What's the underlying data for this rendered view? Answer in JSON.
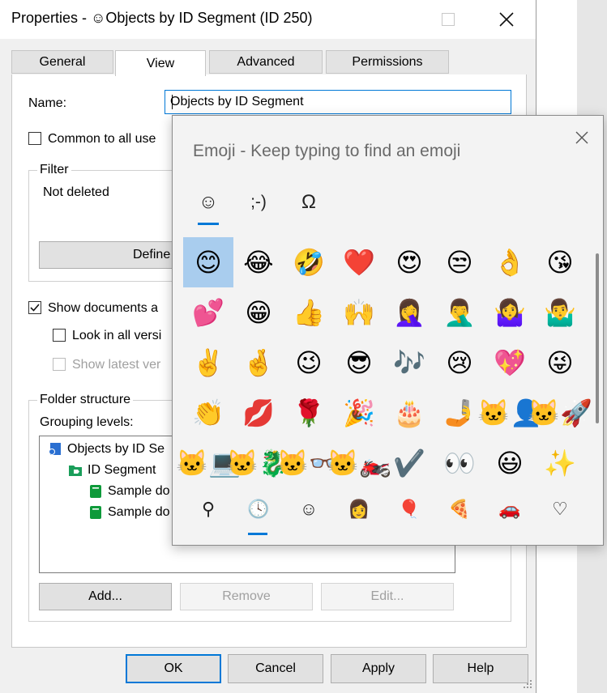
{
  "window": {
    "title": "Properties - ☺Objects by ID Segment (ID 250)"
  },
  "tabs": [
    {
      "label": "General"
    },
    {
      "label": "View"
    },
    {
      "label": "Advanced"
    },
    {
      "label": "Permissions"
    }
  ],
  "form": {
    "name_label": "Name:",
    "name_value": "Objects by ID Segment",
    "common_label": "Common to all use",
    "filter_title": "Filter",
    "filter_text": "Not deleted",
    "define_filter_label": "Define Fi",
    "show_documents_label": "Show documents a",
    "look_all_versions_label": "Look in all versi",
    "show_latest_label": "Show latest ver",
    "folder_structure_title": "Folder structure",
    "grouping_levels_label": "Grouping levels:",
    "tree": [
      {
        "label": "Objects by ID Se"
      },
      {
        "label": "ID Segment"
      },
      {
        "label": "Sample do"
      },
      {
        "label": "Sample do"
      }
    ],
    "add_label": "Add...",
    "remove_label": "Remove",
    "edit_label": "Edit..."
  },
  "footer": {
    "ok_label": "OK",
    "cancel_label": "Cancel",
    "apply_label": "Apply",
    "help_label": "Help"
  },
  "emoji_panel": {
    "hint": "Emoji - Keep typing to find an emoji",
    "tabs": [
      {
        "glyph": "☺",
        "icon": "emoji-tab-icon"
      },
      {
        "glyph": ";-)",
        "icon": "kaomoji-tab-icon"
      },
      {
        "glyph": "Ω",
        "icon": "symbols-tab-icon"
      }
    ],
    "grid": [
      [
        "😊",
        "😂",
        "🤣",
        "❤️",
        "😍",
        "😒",
        "👌",
        "😘"
      ],
      [
        "💕",
        "😁",
        "👍",
        "🙌",
        "🤦‍♀️",
        "🤦‍♂️",
        "🤷‍♀️",
        "🤷‍♂️"
      ],
      [
        "✌️",
        "🤞",
        "😉",
        "😎",
        "🎶",
        "😢",
        "💖",
        "😜"
      ],
      [
        "👏",
        "💋",
        "🌹",
        "🎉",
        "🎂",
        "🤳",
        "🐱‍👤",
        "🐱‍🚀"
      ],
      [
        "🐱‍💻",
        "🐱‍🐉",
        "🐱‍👓",
        "🐱‍🏍",
        "✔️",
        "👀",
        "😃",
        "✨"
      ]
    ],
    "categories": [
      {
        "glyph": "⚲",
        "icon": "search-icon"
      },
      {
        "glyph": "🕓",
        "icon": "recent-clock-icon"
      },
      {
        "glyph": "☺",
        "icon": "smiley-faces-icon"
      },
      {
        "glyph": "👩",
        "icon": "people-icon"
      },
      {
        "glyph": "🎈",
        "icon": "balloon-icon"
      },
      {
        "glyph": "🍕",
        "icon": "food-pizza-icon"
      },
      {
        "glyph": "🚗",
        "icon": "car-icon"
      },
      {
        "glyph": "♡",
        "icon": "heart-icon"
      }
    ]
  },
  "colors": {
    "accent": "#0078d7",
    "selected_emoji_bg": "#a9cdee",
    "folder_icon": "#1a9e5a",
    "document_icon": "#0e9a3a"
  }
}
